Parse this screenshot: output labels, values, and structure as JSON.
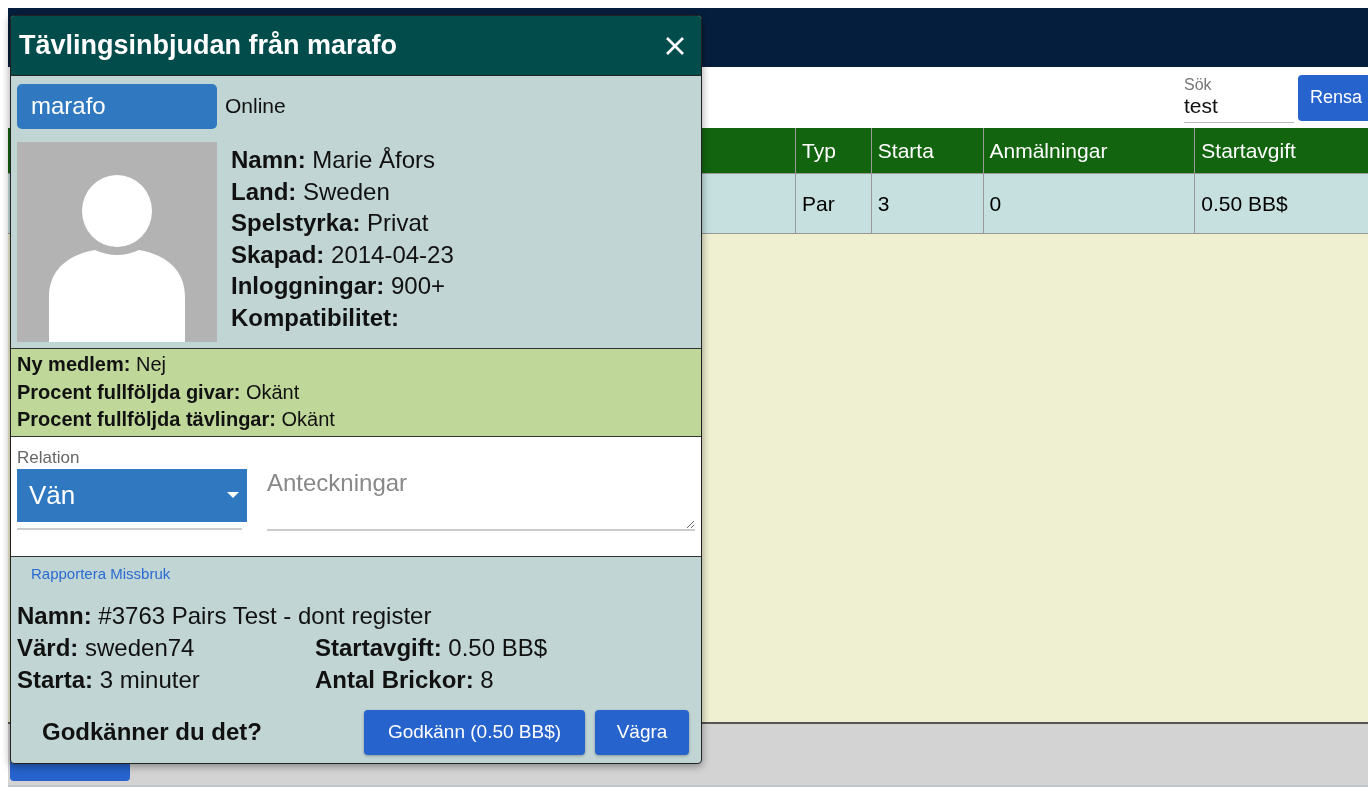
{
  "background": {
    "search": {
      "label": "Sök",
      "value": "test"
    },
    "clear_button": "Rensa",
    "table": {
      "columns": [
        "Typ",
        "Starta",
        "Anmälningar",
        "Startavgift"
      ],
      "rows": [
        [
          "Par",
          "3",
          "0",
          "0.50 BB$"
        ]
      ]
    }
  },
  "dialog": {
    "title": "Tävlingsinbjudan från marafo",
    "user": {
      "name": "marafo",
      "status": "Online"
    },
    "profile": [
      "**Namn:** Marie Åfors",
      "**Land:** Sweden",
      "**Spelstyrka:** Privat",
      "**Skapad:** 2014-04-23",
      "**Inloggningar:** 900+",
      "**Kompatibilitet:**"
    ],
    "stats": [
      "**Ny medlem:** Nej",
      "**Procent fullföljda givar:** Okänt",
      "**Procent fullföljda tävlingar:** Okänt"
    ],
    "relation": {
      "label": "Relation",
      "value": "Vän"
    },
    "notes": {
      "placeholder": "Anteckningar"
    },
    "report_link": "Rapportera Missbruk",
    "tournament": {
      "name": "**Namn:** #3763 Pairs Test - dont register",
      "details": [
        [
          "**Värd:** sweden74",
          "**Startavgift:** 0.50 BB$"
        ],
        [
          "**Starta:** 3 minuter",
          "**Antal Brickor:** 8"
        ]
      ]
    },
    "question": "Godkänner du det?",
    "buttons": [
      "Godkänn (0.50 BB$)",
      "Vägra"
    ]
  }
}
